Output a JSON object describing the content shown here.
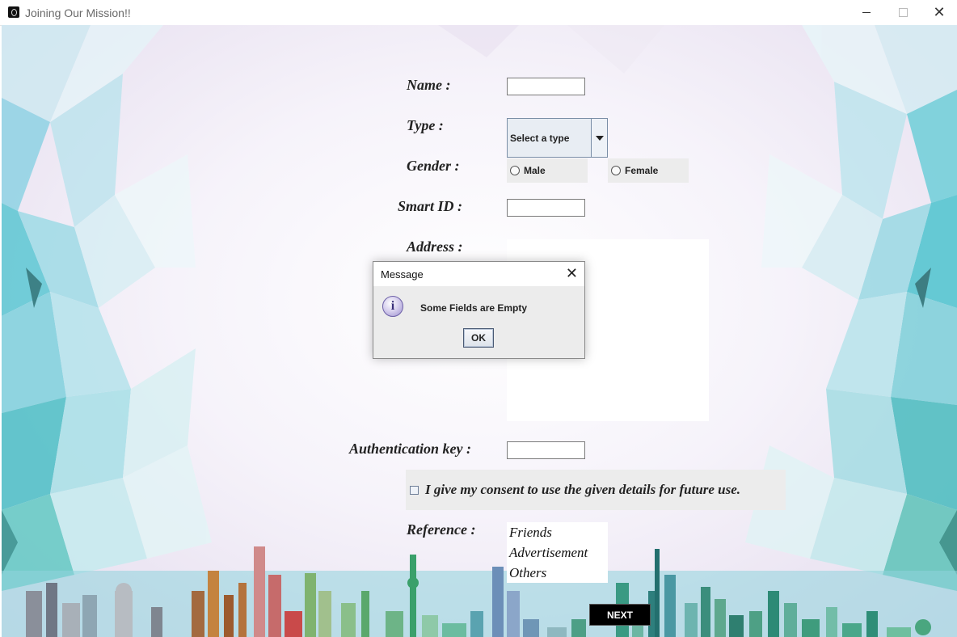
{
  "window": {
    "title": "Joining Our Mission!!",
    "controls": {
      "minimize": "minimize-icon",
      "maximize": "maximize-icon",
      "close": "✕"
    }
  },
  "form": {
    "name_label": "Name :",
    "type_label": "Type :",
    "type_select_value": "Select a type",
    "gender_label": "Gender :",
    "gender_options": [
      "Male",
      "Female"
    ],
    "smart_id_label": "Smart ID :",
    "address_label": "Address :",
    "auth_key_label": "Authentication key :",
    "consent_text": "I give my consent to use the given details for future use.",
    "reference_label": "Reference :",
    "reference_options": [
      "Friends",
      "Advertisement",
      "Others"
    ],
    "next_label": "NEXT"
  },
  "dialog": {
    "title": "Message",
    "close": "✕",
    "message": "Some Fields are Empty",
    "ok_label": "OK",
    "icon": "info-icon"
  },
  "colors": {
    "accent_teal": "#4fc3c9",
    "accent_blue": "#6aaed8",
    "button_black": "#000000"
  }
}
